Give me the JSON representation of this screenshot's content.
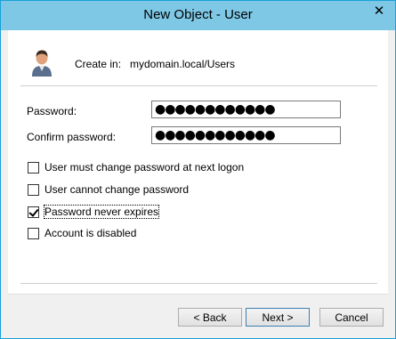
{
  "window": {
    "title": "New Object - User",
    "close_glyph": "✕"
  },
  "header": {
    "icon": "user-icon",
    "create_in_label": "Create in:",
    "create_in_value": "mydomain.local/Users"
  },
  "fields": {
    "password_label": "Password:",
    "password_value": "●●●●●●●●●●●●",
    "confirm_label": "Confirm password:",
    "confirm_value": "●●●●●●●●●●●●"
  },
  "options": [
    {
      "label": "User must change password at next logon",
      "checked": false
    },
    {
      "label": "User cannot change password",
      "checked": false
    },
    {
      "label": "Password never expires",
      "checked": true
    },
    {
      "label": "Account is disabled",
      "checked": false
    }
  ],
  "buttons": {
    "back": "< Back",
    "next": "Next >",
    "cancel": "Cancel"
  },
  "colors": {
    "titlebar": "#7ec8e6",
    "border": "#1aa0d8"
  }
}
